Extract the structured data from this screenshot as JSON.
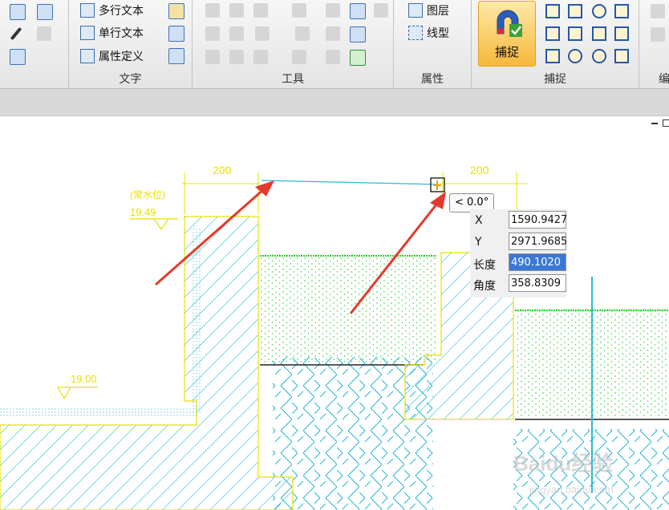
{
  "ribbon": {
    "text_group": {
      "label": "文字",
      "multiline_text": "多行文本",
      "single_text": "单行文本",
      "attribute_define": "属性定义"
    },
    "tools_group": {
      "label": "工具"
    },
    "properties_group": {
      "label": "属性",
      "layer": "图层",
      "linetype": "线型"
    },
    "snap_group": {
      "label": "捕捉",
      "snap_button": "捕捉"
    },
    "cut_label": "编"
  },
  "drawing": {
    "dimension_left": "200",
    "dimension_right": "200",
    "water_level_label": "(常水位)",
    "elevation_upper": "19.49",
    "elevation_lower": "19.00",
    "angle_tooltip": "< 0.0°"
  },
  "coords": {
    "x_label": "X",
    "x_value": "1590.9427",
    "y_label": "Y",
    "y_value": "2971.9685",
    "length_label": "长度",
    "length_value": "490.1020",
    "angle_label": "角度",
    "angle_value": "358.8309"
  },
  "watermark": {
    "brand": "Baidu经验",
    "url": "jingyan.baidu.com"
  },
  "colors": {
    "accent": "#f3a100",
    "cad_cyan": "#30b8d8",
    "cad_yellow": "#e8e100",
    "cad_green": "#2ed12e",
    "arrow_red": "#e23b2e"
  }
}
